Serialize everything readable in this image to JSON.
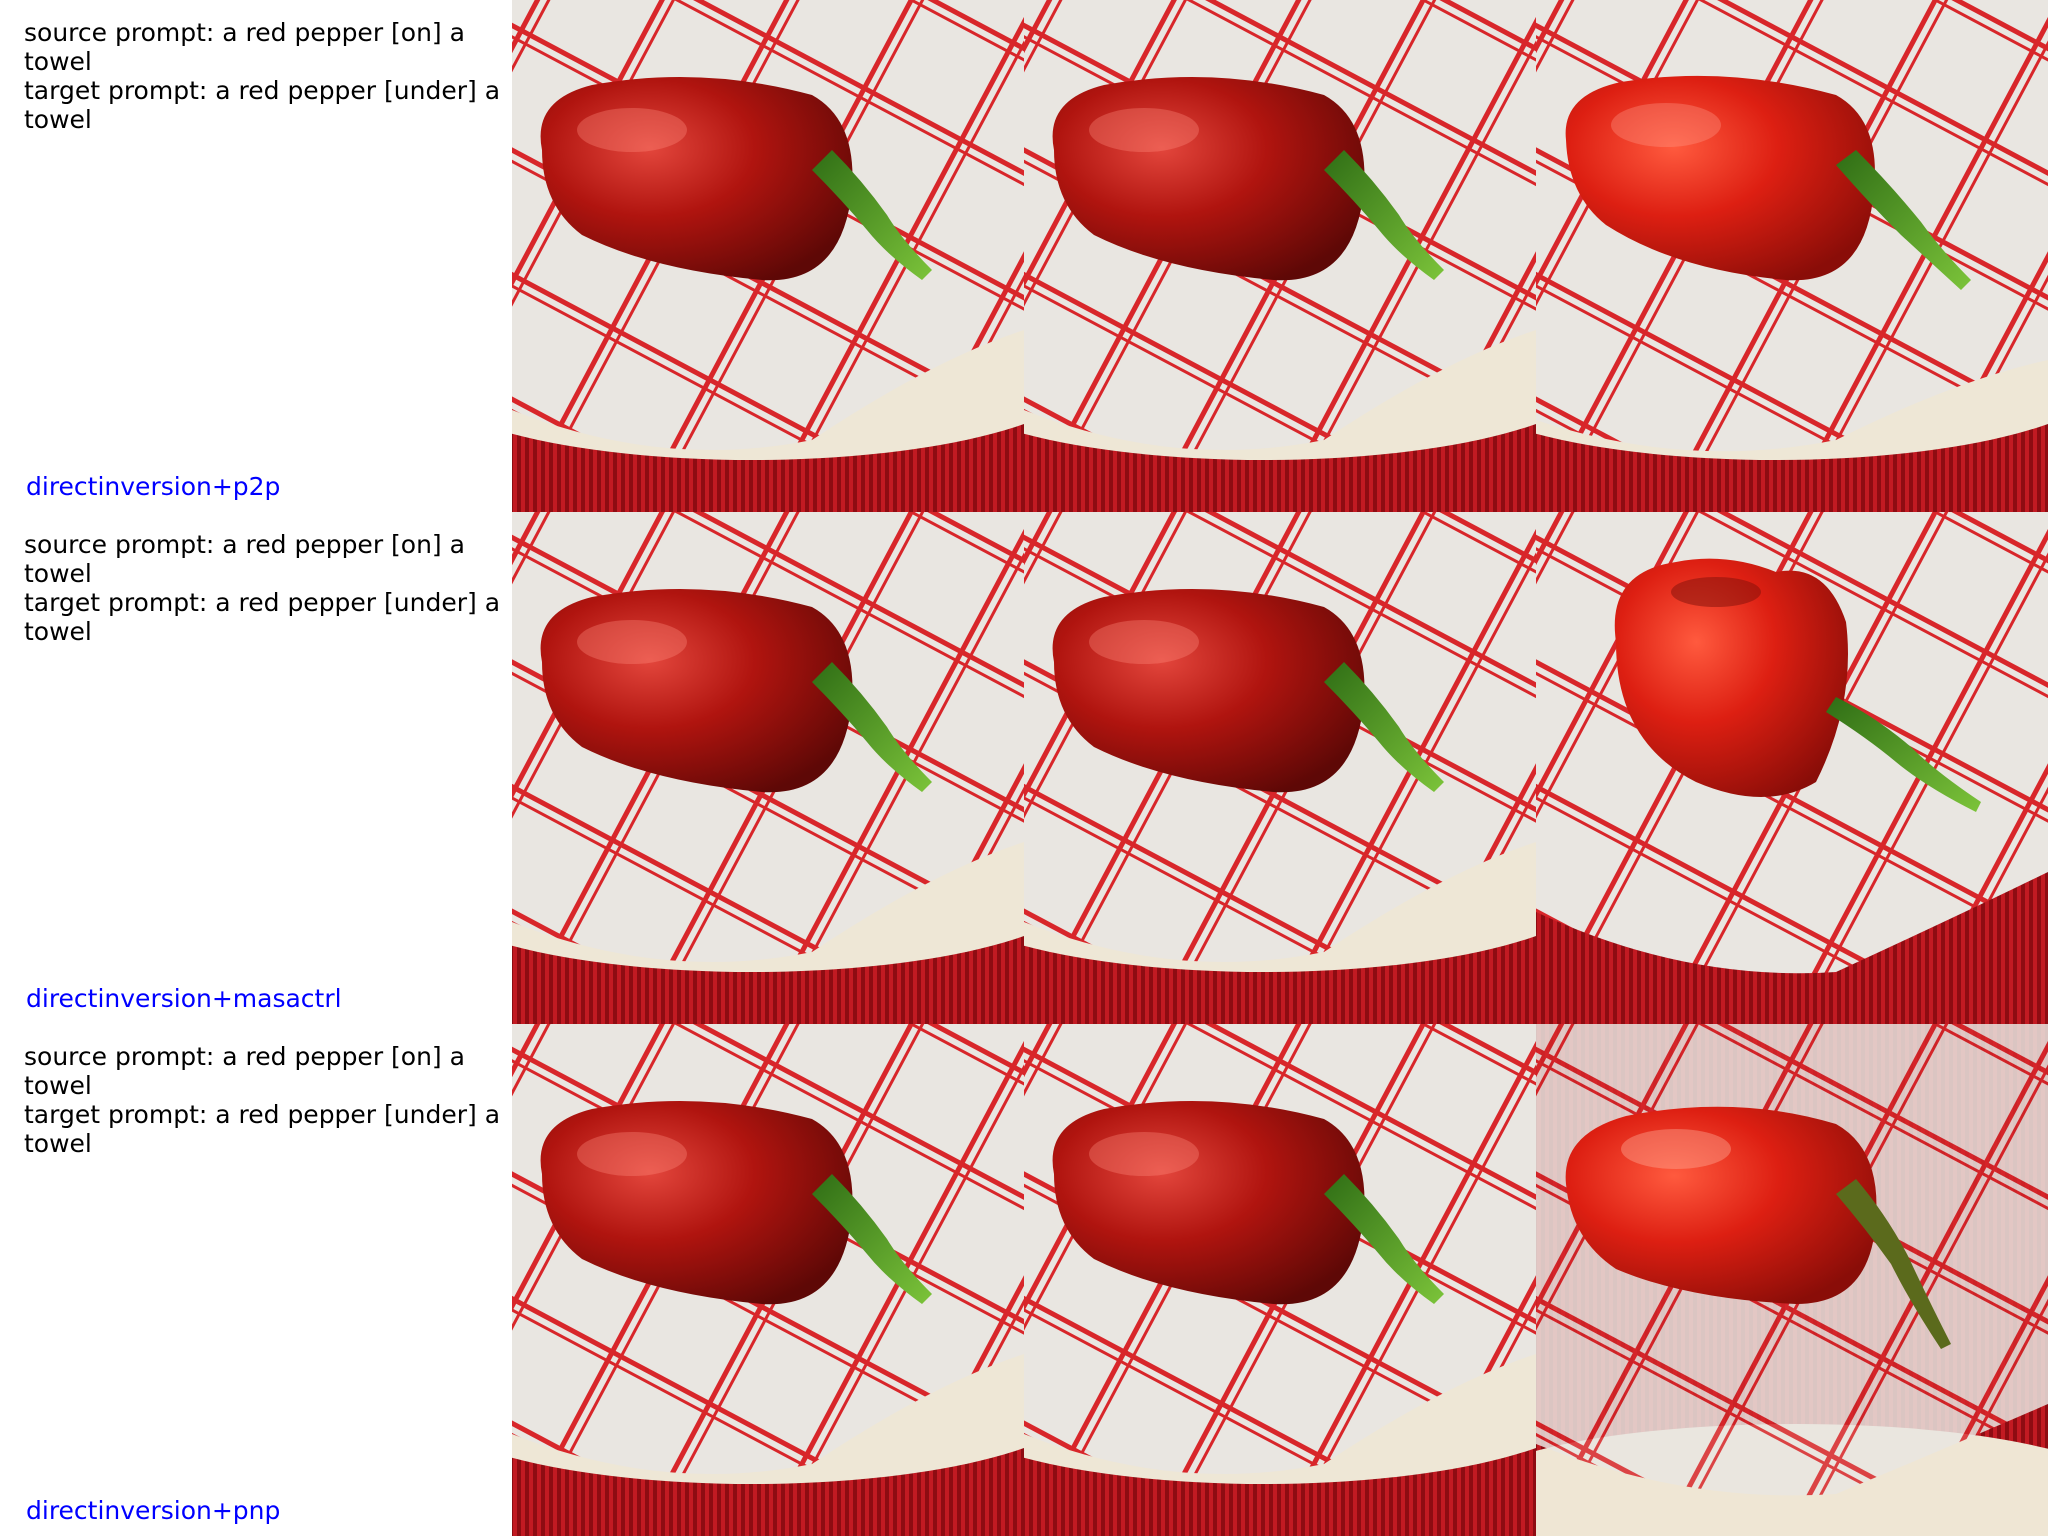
{
  "accent_colors": {
    "method_label": "#0000ff",
    "pepper_red": "#b0140f",
    "stem_green": "#5aa826",
    "towel_stripe": "#d8262a"
  },
  "rows": [
    {
      "source_prompt": "source prompt: a red pepper [on] a",
      "source_prompt_wrap": "towel",
      "target_prompt": "target prompt: a red pepper [under] a",
      "target_prompt_wrap": "towel",
      "method": "directinversion+p2p"
    },
    {
      "source_prompt": "source prompt: a red pepper [on] a",
      "source_prompt_wrap": "towel",
      "target_prompt": "target prompt: a red pepper [under] a",
      "target_prompt_wrap": "towel",
      "method": "directinversion+masactrl"
    },
    {
      "source_prompt": "source prompt: a red pepper [on] a",
      "source_prompt_wrap": "towel",
      "target_prompt": "target prompt: a red pepper [under] a",
      "target_prompt_wrap": "towel",
      "method": "directinversion+pnp"
    }
  ]
}
